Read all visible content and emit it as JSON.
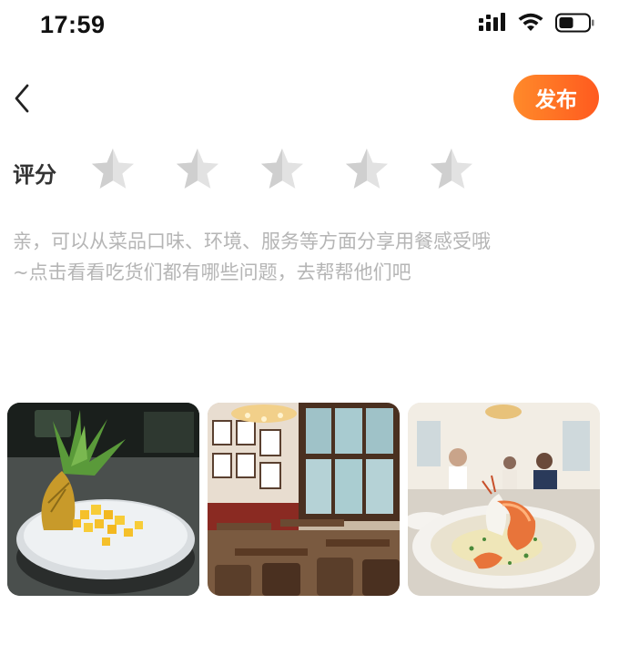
{
  "status_bar": {
    "time": "17:59",
    "icons": [
      "signal-icon",
      "wifi-icon",
      "battery-icon"
    ]
  },
  "nav": {
    "back_icon": "chevron-left-icon",
    "publish_label": "发布",
    "publish_color": "#ff6b22"
  },
  "rating": {
    "label": "评分",
    "star_count": 5,
    "selected": 0,
    "star_color": "#d8d8d8"
  },
  "review": {
    "placeholder": "亲，可以从菜品口味、环境、服务等方面分享用餐感受哦\n~点击看看吃货们都有哪些问题，去帮帮他们吧"
  },
  "photos": [
    {
      "subject": "pineapple-dish-photo"
    },
    {
      "subject": "restaurant-interior-photo"
    },
    {
      "subject": "shrimp-dish-photo"
    }
  ]
}
